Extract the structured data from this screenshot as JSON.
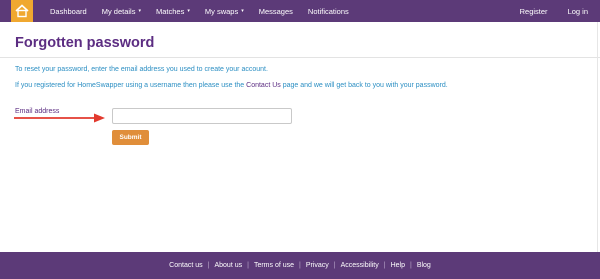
{
  "nav": {
    "items": [
      {
        "label": "Dashboard",
        "dropdown": false
      },
      {
        "label": "My details",
        "dropdown": true
      },
      {
        "label": "Matches",
        "dropdown": true
      },
      {
        "label": "My swaps",
        "dropdown": true
      },
      {
        "label": "Messages",
        "dropdown": false
      },
      {
        "label": "Notifications",
        "dropdown": false
      }
    ],
    "register": "Register",
    "login": "Log in",
    "caret": "▾"
  },
  "page": {
    "title": "Forgotten password",
    "intro": "To reset your password, enter the email address you used to create your account.",
    "hint_before": "If you registered for HomeSwapper using a username then please use the ",
    "hint_link": "Contact Us",
    "hint_after": " page and we will get back to you with your password."
  },
  "form": {
    "email_label": "Email address",
    "email_value": "",
    "submit": "Submit"
  },
  "footer": {
    "links": [
      "Contact us",
      "About us",
      "Terms of use",
      "Privacy",
      "Accessibility",
      "Help",
      "Blog"
    ],
    "separator": "|"
  },
  "colors": {
    "brand_purple": "#5c3a78",
    "accent_orange": "#e08e3a",
    "text_blue": "#2c8fc3",
    "arrow_red": "#e23a2e"
  }
}
